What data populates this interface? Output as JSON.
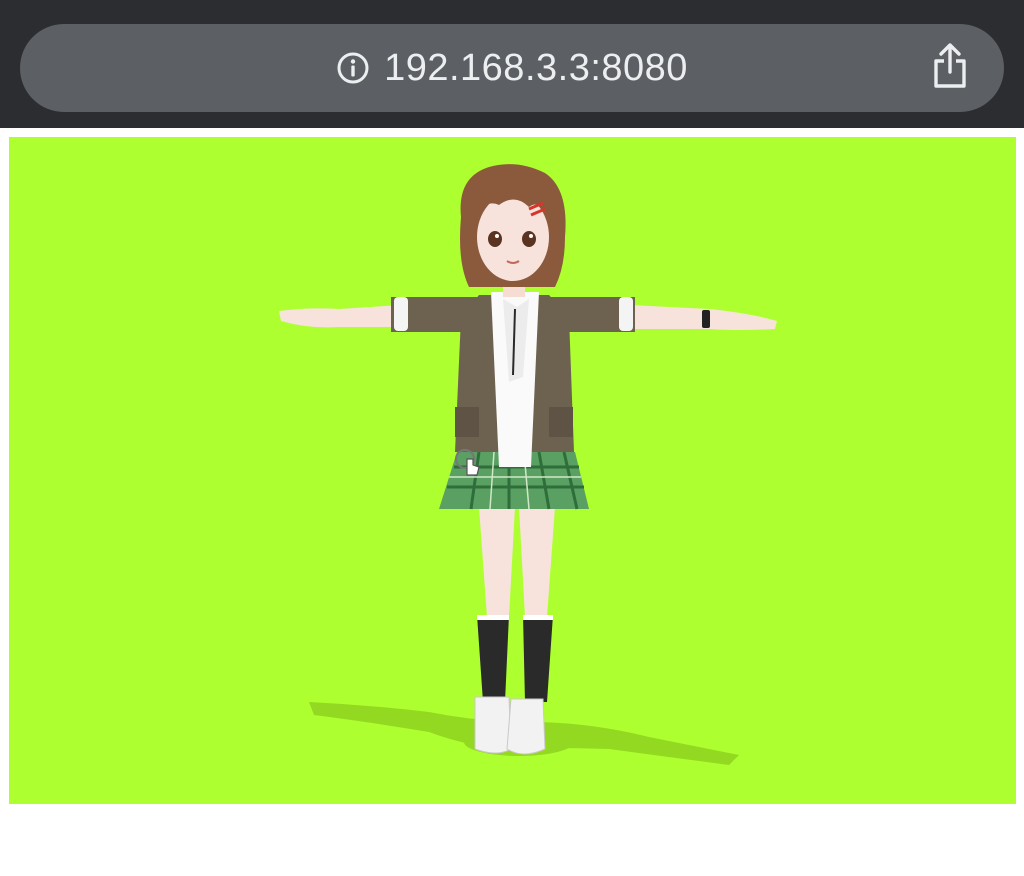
{
  "browser": {
    "url": "192.168.3.3:8080",
    "info_icon": "info-icon",
    "share_icon": "share-icon"
  },
  "scene": {
    "background_color": "#adff2f",
    "subject": "3D character model in T-pose"
  }
}
